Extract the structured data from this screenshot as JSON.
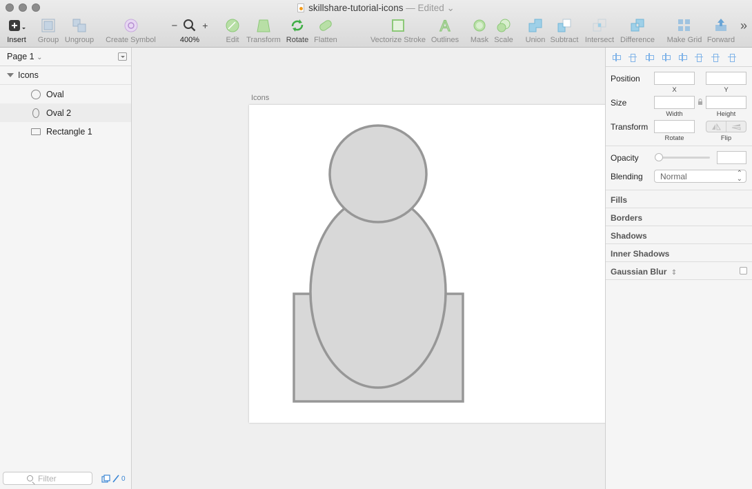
{
  "window": {
    "title": "skillshare-tutorial-icons",
    "edited_text": "— Edited"
  },
  "toolbar": {
    "insert": "Insert",
    "group": "Group",
    "ungroup": "Ungroup",
    "create_symbol": "Create Symbol",
    "zoom_minus": "−",
    "zoom_plus": "+",
    "zoom_level": "400%",
    "edit": "Edit",
    "transform": "Transform",
    "rotate": "Rotate",
    "flatten": "Flatten",
    "vectorize_stroke": "Vectorize Stroke",
    "outlines": "Outlines",
    "mask": "Mask",
    "scale": "Scale",
    "union": "Union",
    "subtract": "Subtract",
    "intersect": "Intersect",
    "difference": "Difference",
    "make_grid": "Make Grid",
    "forward": "Forward",
    "more": "»"
  },
  "layers_panel": {
    "page": "Page 1",
    "group": "Icons",
    "items": [
      {
        "label": "Oval",
        "shape": "circle-icon"
      },
      {
        "label": "Oval 2",
        "shape": "ellipse-icon"
      },
      {
        "label": "Rectangle 1",
        "shape": "rectangle-icon"
      }
    ],
    "filter_placeholder": "Filter",
    "count": "0"
  },
  "canvas": {
    "artboard_label": "Icons",
    "shape_fill": "#d8d8d8",
    "shape_stroke": "#979797"
  },
  "inspector": {
    "position": "Position",
    "x_label": "X",
    "y_label": "Y",
    "size": "Size",
    "width_label": "Width",
    "height_label": "Height",
    "transform": "Transform",
    "rotate_label": "Rotate",
    "flip_label": "Flip",
    "opacity": "Opacity",
    "blending": "Blending",
    "blending_value": "Normal",
    "sections": [
      "Fills",
      "Borders",
      "Shadows",
      "Inner Shadows",
      "Gaussian Blur"
    ]
  }
}
